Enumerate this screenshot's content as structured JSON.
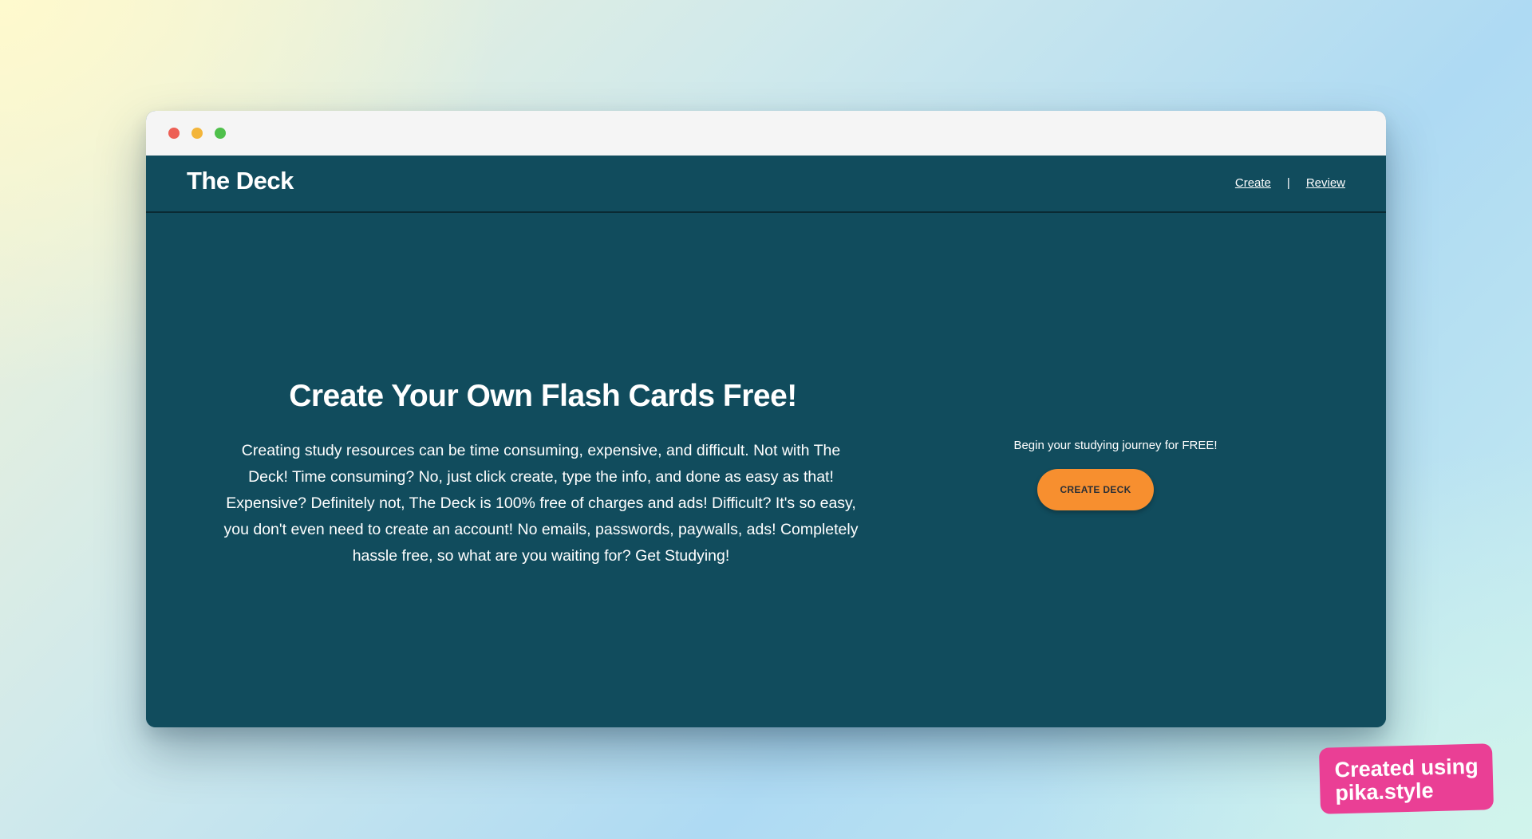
{
  "browser": {
    "window_controls": [
      "close",
      "minimize",
      "maximize"
    ]
  },
  "navbar": {
    "brand": "The Deck",
    "links": [
      {
        "label": "Create"
      },
      {
        "label": "Review"
      }
    ],
    "separator": "|"
  },
  "hero": {
    "title": "Create Your Own Flash Cards Free!",
    "description": "Creating study resources can be time consuming, expensive, and difficult. Not with The Deck! Time consuming? No, just click create, type the info, and done as easy as that! Expensive? Definitely not, The Deck is 100% free of charges and ads! Difficult? It's so easy, you don't even need to create an account! No emails, passwords, paywalls, ads! Completely hassle free, so what are you waiting for? Get Studying!"
  },
  "cta": {
    "caption": "Begin your studying journey for FREE!",
    "button_label": "CREATE DECK"
  },
  "badge": {
    "line1": "Created using",
    "line2": "pika.style"
  },
  "colors": {
    "page_bg": "#114c5d",
    "accent": "#f78f2f",
    "badge": "#ea3f95"
  }
}
